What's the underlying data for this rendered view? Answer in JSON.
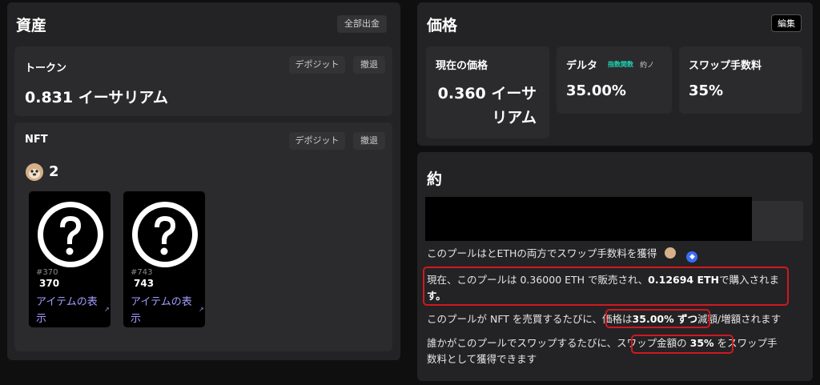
{
  "assets": {
    "title": "資産",
    "withdraw_all_label": "全部出金",
    "token": {
      "label": "トークン",
      "deposit_label": "デポジット",
      "withdraw_label": "撤退",
      "amount": "0.831 イーサリアム"
    },
    "nft": {
      "label": "NFT",
      "deposit_label": "デポジット",
      "withdraw_label": "撤退",
      "count": "2",
      "items": [
        {
          "id_label": "#370",
          "number": "370",
          "view_label": "アイテムの表示"
        },
        {
          "id_label": "#743",
          "number": "743",
          "view_label": "アイテムの表示"
        }
      ]
    }
  },
  "price": {
    "title": "価格",
    "edit_label": "編集",
    "current_price_label": "現在の価格",
    "current_price_value": "0.360 イーサリアム",
    "delta_label": "デルタ",
    "delta_type": "指数関数",
    "delta_note": "約ノ",
    "delta_value": "35.00%",
    "swap_fee_label": "スワップ手数料",
    "swap_fee_value": "35%"
  },
  "about": {
    "title": "約",
    "line1": "このプールはとETHの両方でスワップ手数料を獲得",
    "line2_a": "現在、このプールは 0.36000 ETH で販売され、",
    "line2_b": "0.12694 ETH",
    "line2_c": "で購入されま",
    "line2_d": "す。",
    "line3_a": "このプールが NFT を売買するたびに、",
    "line3_b": "価格は",
    "line3_c": "35.00% ずつ",
    "line3_d": "減額/増額されます",
    "line4_a": "誰かがこのプールでスワップするたびに、",
    "line4_b": "スワップ金額の ",
    "line4_c": "35%",
    "line4_d": " をスワップ手",
    "line4_e": "数料として獲得できます"
  },
  "colors": {
    "background": "#0f0f10",
    "panel": "#232325",
    "card": "#2b2b2d",
    "link": "#a39bff",
    "highlight": "#d01821",
    "delta_badge": "#1fd1b2",
    "eth_badge": "#3b6cf5"
  }
}
